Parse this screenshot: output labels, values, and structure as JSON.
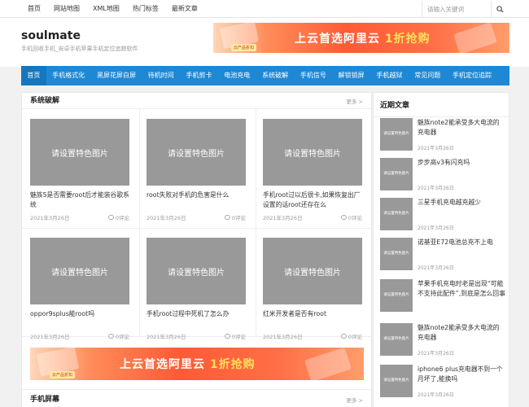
{
  "topnav": [
    "首页",
    "网站地图",
    "XML地图",
    "热门标签",
    "最新文章"
  ],
  "search": {
    "placeholder": "请输入关键词"
  },
  "site": {
    "title": "soulmate",
    "desc": "手机回收手机_安卓手机苹果手机定位追踪软件"
  },
  "ad": {
    "text": "上云首选阿里云",
    "highlight": "1折抢购",
    "tag": "云产品折扣"
  },
  "mainnav": [
    "首页",
    "手机格式化",
    "黑屏花屏白屏",
    "待机时间",
    "手机剪卡",
    "电池充电",
    "系统破解",
    "手机信号",
    "解锁锁屏",
    "手机越狱",
    "常见问题",
    "手机定位追踪"
  ],
  "section1": {
    "title": "系统破解",
    "more": "更多 >",
    "thumb_text": "请设置特色图片",
    "posts": [
      {
        "title": "魅族5是否需要root后才能装谷歌系统",
        "date": "2021年3月26日",
        "comments": "0评论"
      },
      {
        "title": "root失败对手机的危害是什么",
        "date": "2021年3月26日",
        "comments": "0评论"
      },
      {
        "title": "手机root过以后很卡,如果恢复出厂设置的话root还存在么",
        "date": "2021年3月26日",
        "comments": "0评论"
      },
      {
        "title": "oppor9splus能root吗",
        "date": "2021年3月26日",
        "comments": "0评论"
      },
      {
        "title": "手机root过程中死机了怎么办",
        "date": "2021年3月26日",
        "comments": "0评论"
      },
      {
        "title": "红米开发者是否有root",
        "date": "2021年3月26日",
        "comments": "0评论"
      }
    ]
  },
  "section2": {
    "title": "手机屏幕",
    "more": "更多 >"
  },
  "sidebar": {
    "title": "近期文章",
    "thumb_text": "请设置特色图片",
    "items": [
      {
        "title": "魅族note2能承受多大电流的充电器",
        "date": "2021年3月26日"
      },
      {
        "title": "步步高v3有闪充吗",
        "date": "2021年3月26日"
      },
      {
        "title": "三星手机充电越充越少",
        "date": "2021年3月26日"
      },
      {
        "title": "诺基亚E72电池总充不上电",
        "date": "2021年3月26日"
      },
      {
        "title": "苹果手机充电时老是出现“可能不支持此配件”,到底是怎么回事",
        "date": "2021年3月26日"
      },
      {
        "title": "魅族note2能承受多大电流的充电器",
        "date": "2021年3月26日"
      },
      {
        "title": "iphone6 plus充电器不到一个月坏了,能换吗",
        "date": "2021年3月26日"
      }
    ]
  },
  "colors": {
    "nav_blue": "#1e88d5",
    "thumb_gray": "#999999"
  }
}
